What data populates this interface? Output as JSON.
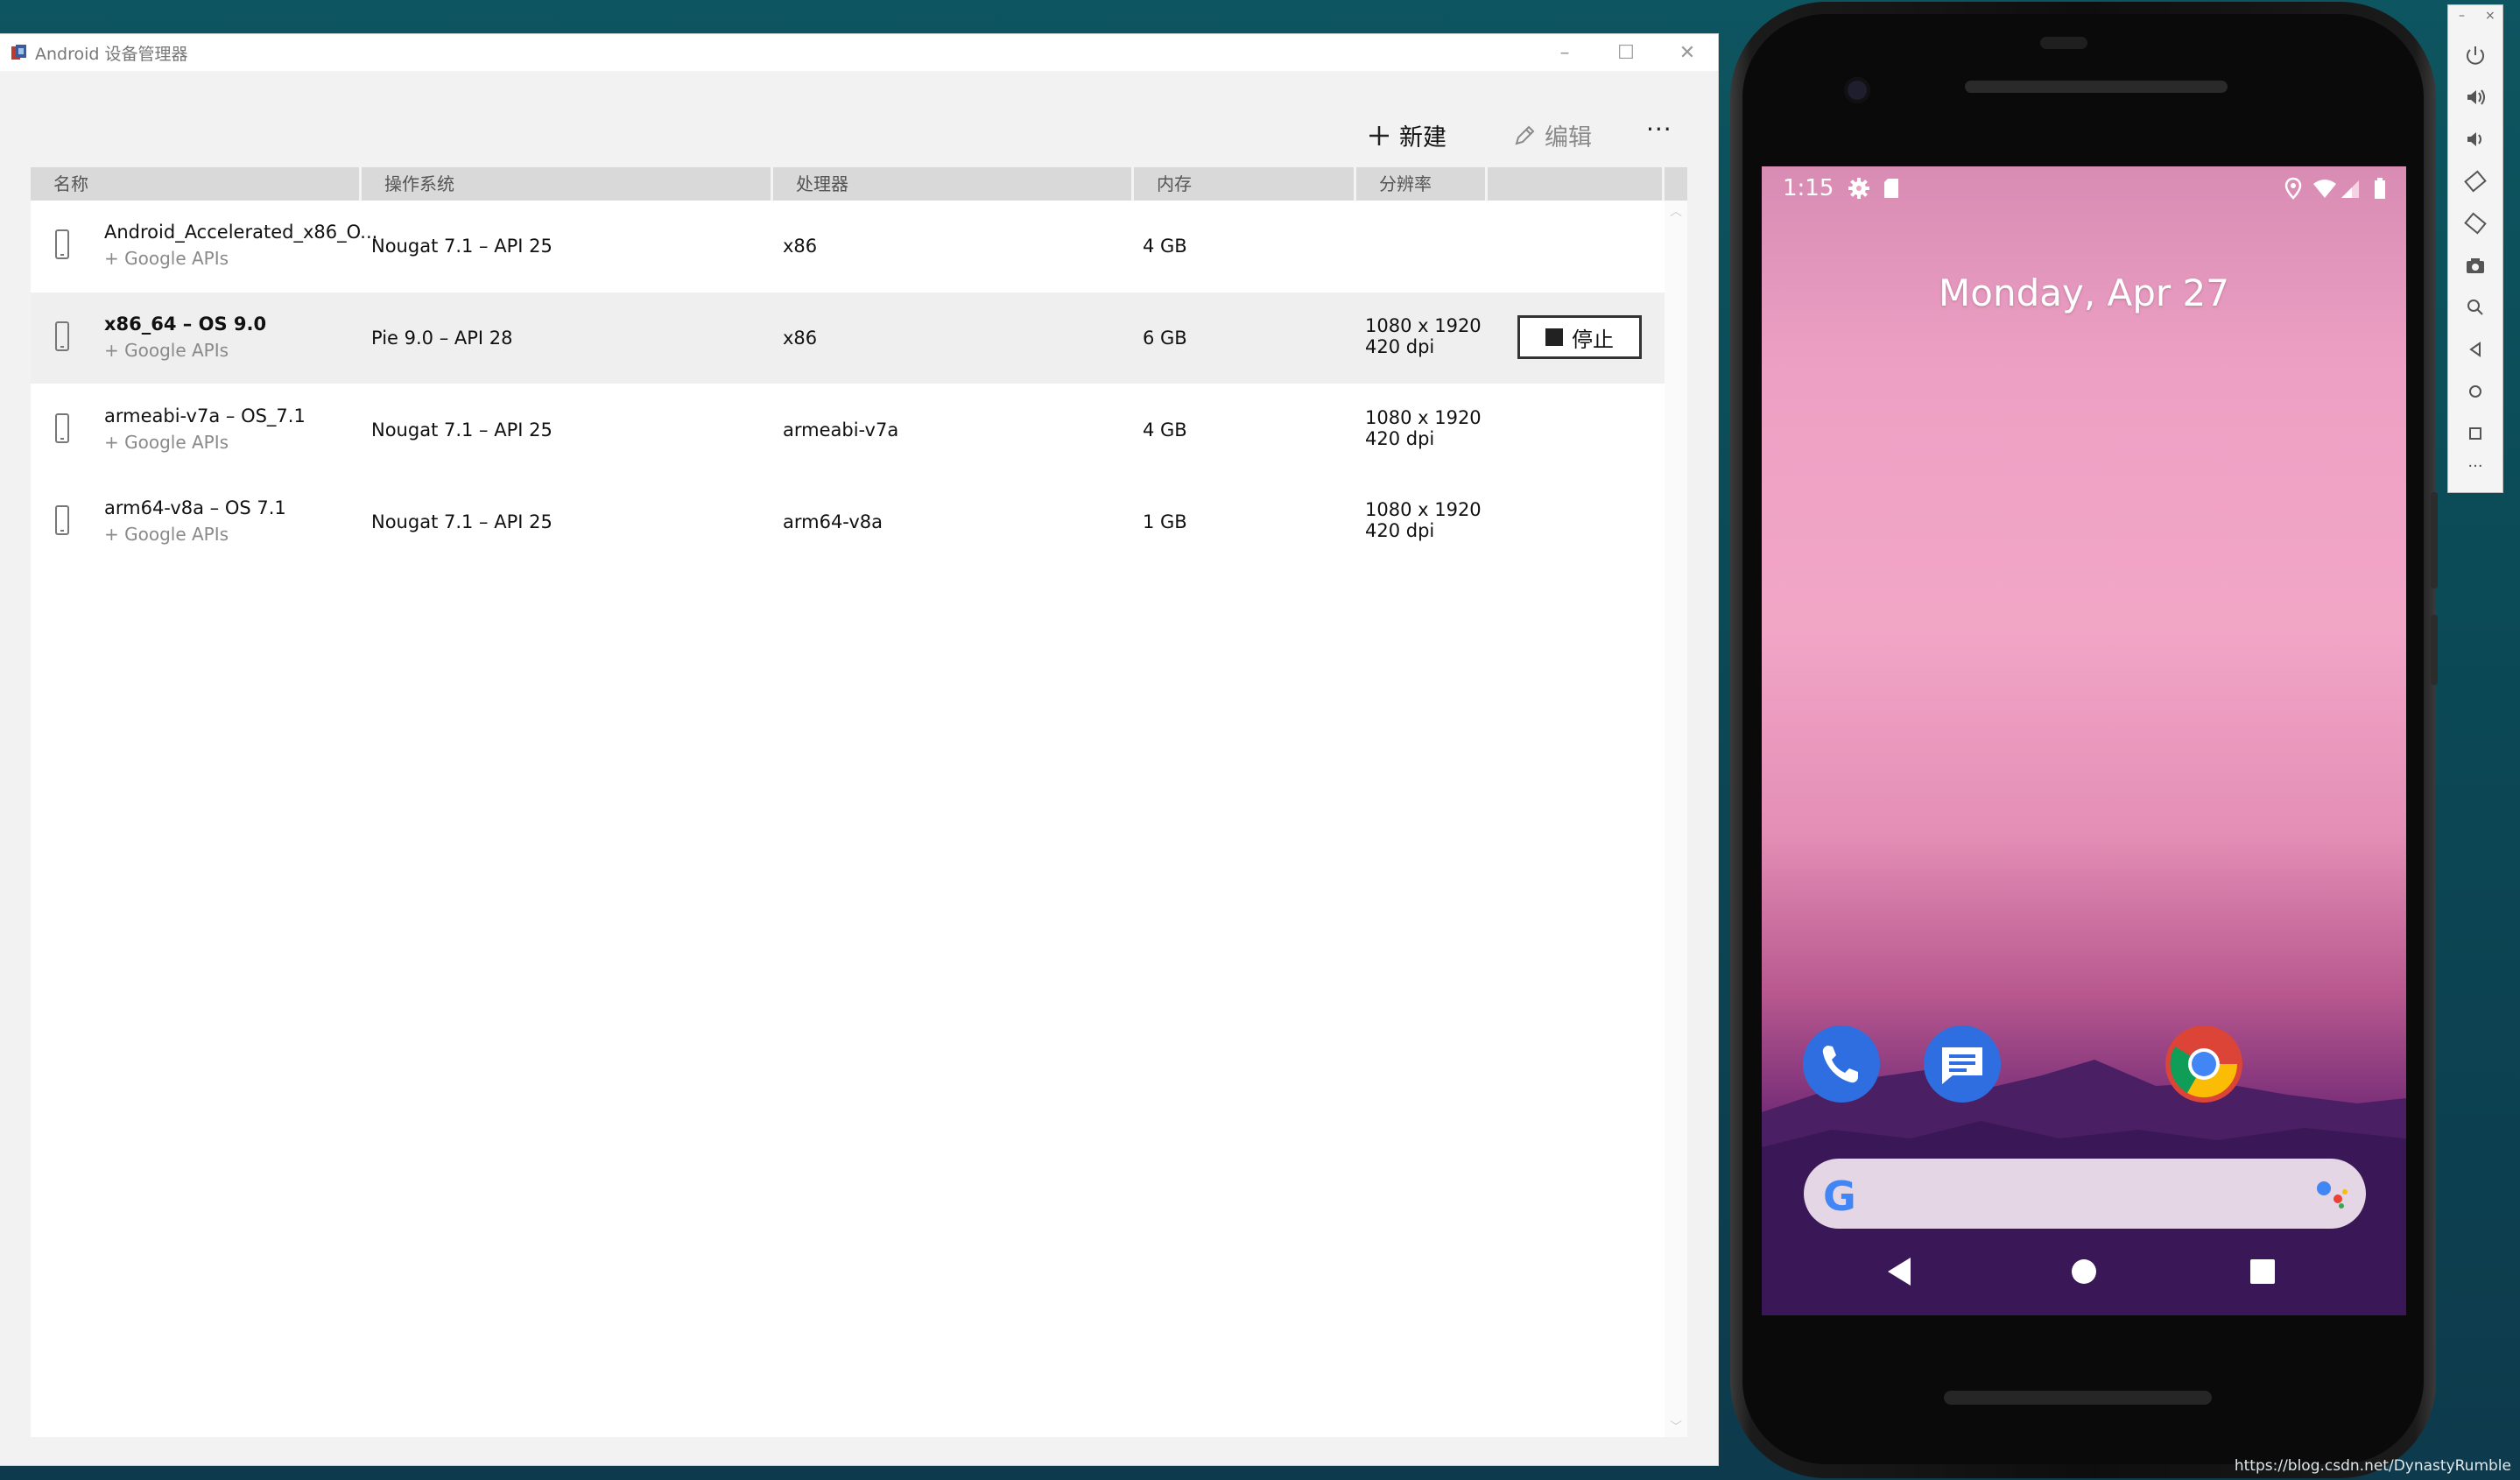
{
  "window": {
    "title": "Android 设备管理器",
    "minimize": "–",
    "maximize": "☐",
    "close": "✕"
  },
  "toolbar": {
    "new_label": "新建",
    "edit_label": "编辑",
    "more_label": "···"
  },
  "table": {
    "headers": [
      "名称",
      "操作系统",
      "处理器",
      "内存",
      "分辨率"
    ],
    "rows": [
      {
        "name": "Android_Accelerated_x86_O...",
        "sub": "+ Google APIs",
        "os": "Nougat 7.1 – API 25",
        "cpu": "x86",
        "mem": "4 GB",
        "res1": "",
        "res2": "",
        "selected": false,
        "bold": false
      },
      {
        "name": "x86_64 – OS 9.0",
        "sub": "+ Google APIs",
        "os": "Pie 9.0 – API 28",
        "cpu": "x86",
        "mem": "6 GB",
        "res1": "1080 x 1920",
        "res2": "420 dpi",
        "selected": true,
        "bold": true,
        "action": "停止"
      },
      {
        "name": "armeabi-v7a – OS_7.1",
        "sub": "+ Google APIs",
        "os": "Nougat 7.1 – API 25",
        "cpu": "armeabi-v7a",
        "mem": "4 GB",
        "res1": "1080 x 1920",
        "res2": "420 dpi",
        "selected": false,
        "bold": false
      },
      {
        "name": "arm64-v8a – OS 7.1",
        "sub": "+ Google APIs",
        "os": "Nougat 7.1 – API 25",
        "cpu": "arm64-v8a",
        "mem": "1 GB",
        "res1": "1080 x 1920",
        "res2": "420 dpi",
        "selected": false,
        "bold": false
      }
    ]
  },
  "phone": {
    "time": "1:15",
    "date": "Monday, Apr 27",
    "apps": [
      "phone-icon",
      "messages-icon",
      "chrome-icon"
    ],
    "search_logo": "G"
  },
  "emulator_toolbar": {
    "minimize": "–",
    "close": "×",
    "more": "···"
  },
  "watermark": "https://blog.csdn.net/DynastyRumble",
  "colors": {
    "desktop": "#0d5560",
    "window_bg": "#f2f2f2",
    "header_bg": "#d9d9d9",
    "selected_row": "#efefef",
    "wallpaper_pink": "#f2a6c6",
    "wallpaper_purple": "#3c1a5a"
  }
}
